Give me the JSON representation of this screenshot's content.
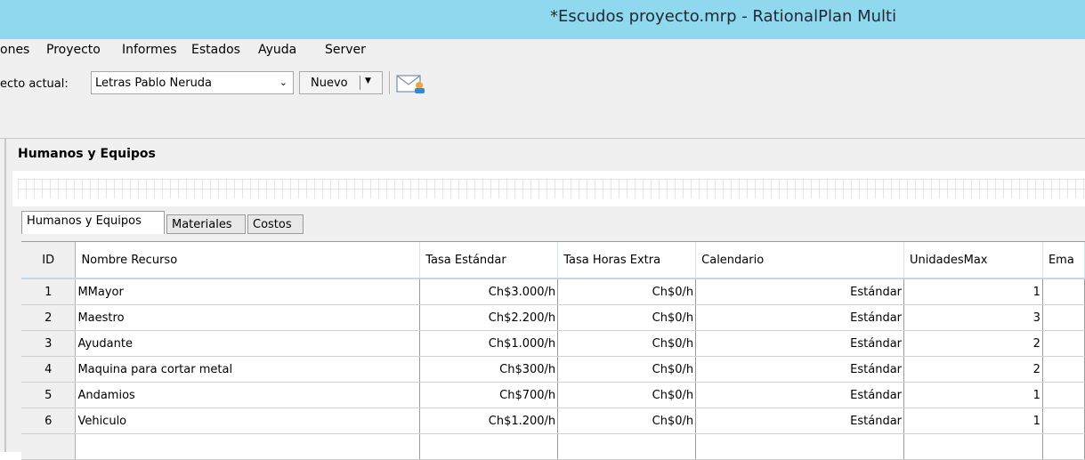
{
  "window": {
    "title": "*Escudos proyecto.mrp - RationalPlan Multi"
  },
  "menu": [
    {
      "label": "ones"
    },
    {
      "label": "Proyecto"
    },
    {
      "label": "Informes"
    },
    {
      "label": "Estados"
    },
    {
      "label": "Ayuda"
    },
    {
      "label": "Server"
    }
  ],
  "toolbar": {
    "project_label": "ecto actual:",
    "project_value": "Letras Pablo Neruda",
    "new_label": "Nuevo",
    "send_icon": "mail-send-icon"
  },
  "section": {
    "title": "Humanos y Equipos"
  },
  "tabs": [
    {
      "label": "Humanos y Equipos",
      "active": true
    },
    {
      "label": "Materiales",
      "active": false
    },
    {
      "label": "Costos",
      "active": false
    }
  ],
  "table": {
    "columns": [
      "ID",
      "Nombre Recurso",
      "Tasa Estándar",
      "Tasa Horas Extra",
      "Calendario",
      "UnidadesMax",
      "Ema"
    ],
    "rows": [
      [
        "1",
        "MMayor",
        "Ch$3.000/h",
        "Ch$0/h",
        "Estándar",
        "1"
      ],
      [
        "2",
        "Maestro",
        "Ch$2.200/h",
        "Ch$0/h",
        "Estándar",
        "3"
      ],
      [
        "3",
        "Ayudante",
        "Ch$1.000/h",
        "Ch$0/h",
        "Estándar",
        "2"
      ],
      [
        "4",
        "Maquina para cortar metal",
        "Ch$300/h",
        "Ch$0/h",
        "Estándar",
        "2"
      ],
      [
        "5",
        "Andamios",
        "Ch$700/h",
        "Ch$0/h",
        "Estándar",
        "1"
      ],
      [
        "6",
        "Vehiculo",
        "Ch$1.200/h",
        "Ch$0/h",
        "Estándar",
        "1"
      ]
    ]
  },
  "colors": {
    "titlebar": "#8fd8ee",
    "chrome": "#f0f0f0",
    "header_border": "#c5d5ea"
  }
}
